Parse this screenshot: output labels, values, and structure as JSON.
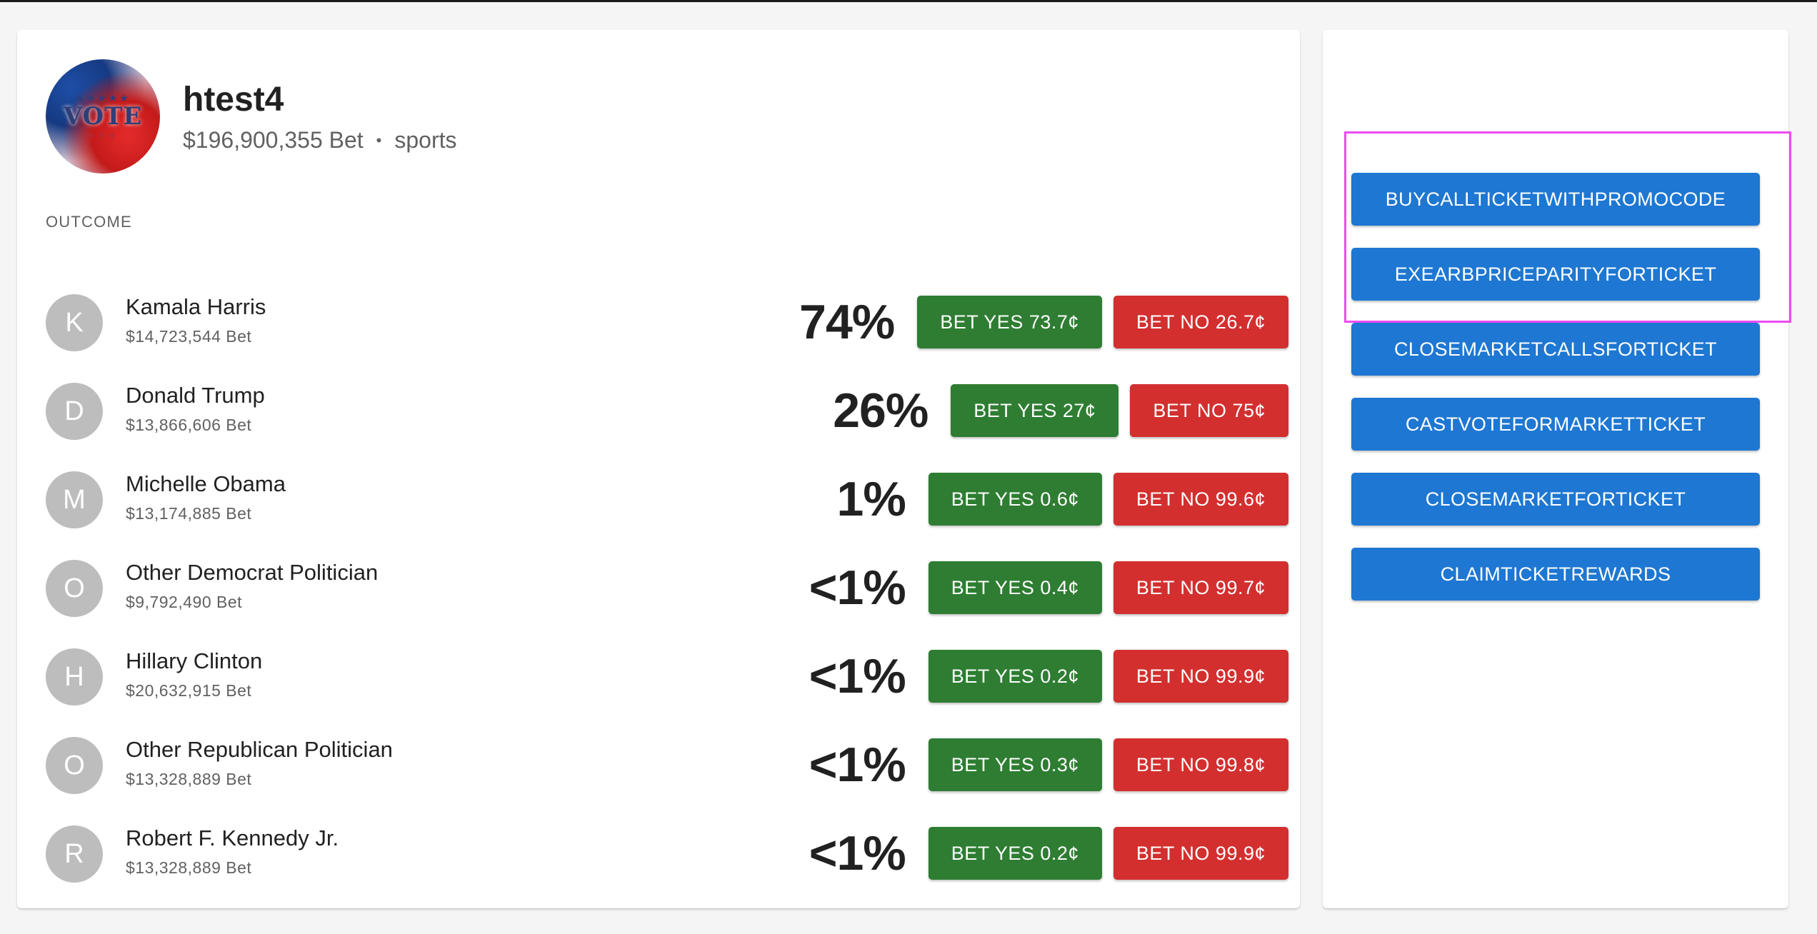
{
  "market": {
    "avatar_text": "VOTE",
    "title": "htest4",
    "volume": "$196,900,355 Bet",
    "separator": "•",
    "category": "sports"
  },
  "outcome_label": "OUTCOME",
  "outcomes": [
    {
      "initial": "K",
      "name": "Kamala Harris",
      "volume": "$14,723,544 Bet",
      "percent": "74%",
      "yes": "BET YES 73.7¢",
      "no": "BET NO 26.7¢"
    },
    {
      "initial": "D",
      "name": "Donald Trump",
      "volume": "$13,866,606 Bet",
      "percent": "26%",
      "yes": "BET YES 27¢",
      "no": "BET NO 75¢"
    },
    {
      "initial": "M",
      "name": "Michelle Obama",
      "volume": "$13,174,885 Bet",
      "percent": "1%",
      "yes": "BET YES 0.6¢",
      "no": "BET NO 99.6¢"
    },
    {
      "initial": "O",
      "name": "Other Democrat Politician",
      "volume": "$9,792,490 Bet",
      "percent": "<1%",
      "yes": "BET YES 0.4¢",
      "no": "BET NO 99.7¢"
    },
    {
      "initial": "H",
      "name": "Hillary Clinton",
      "volume": "$20,632,915 Bet",
      "percent": "<1%",
      "yes": "BET YES 0.2¢",
      "no": "BET NO 99.9¢"
    },
    {
      "initial": "O",
      "name": "Other Republican Politician",
      "volume": "$13,328,889 Bet",
      "percent": "<1%",
      "yes": "BET YES 0.3¢",
      "no": "BET NO 99.8¢"
    },
    {
      "initial": "R",
      "name": "Robert F. Kennedy Jr.",
      "volume": "$13,328,889 Bet",
      "percent": "<1%",
      "yes": "BET YES 0.2¢",
      "no": "BET NO 99.9¢"
    }
  ],
  "actions": [
    "BUYCALLTICKETWITHPROMOCODE",
    "EXEARBPRICEPARITYFORTICKET",
    "CLOSEMARKETCALLSFORTICKET",
    "CASTVOTEFORMARKETTICKET",
    "CLOSEMARKETFORTICKET",
    "CLAIMTICKETREWARDS"
  ],
  "colors": {
    "yes": "#2e7d32",
    "no": "#d32f2f",
    "action": "#1e77d2",
    "highlight": "#ec4cf0",
    "avatar_bg": "#bdbdbd"
  }
}
